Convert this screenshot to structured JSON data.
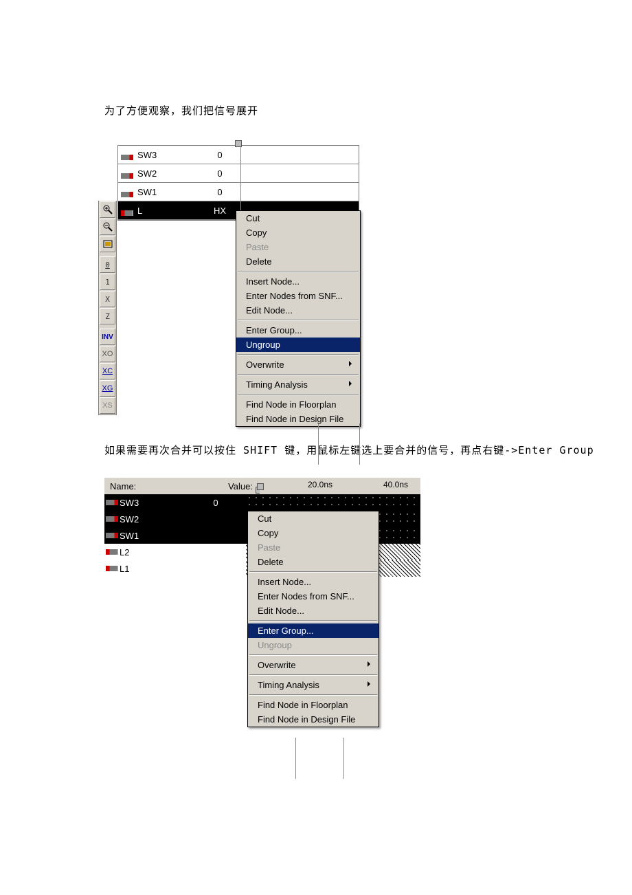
{
  "text": {
    "para1": "为了方便观察，我们把信号展开",
    "para2": "如果需要再次合并可以按住 SHIFT 键，用鼠标左键选上要合并的信号，再点右键->Enter Group"
  },
  "toolbar_icons": [
    "zoom-in",
    "zoom-out",
    "fit",
    "0",
    "1",
    "X",
    "Z",
    "INV",
    "XO",
    "XC",
    "XG",
    "XS"
  ],
  "shot1": {
    "signals": [
      {
        "name": "SW3",
        "value": "0",
        "type": "in",
        "sel": false
      },
      {
        "name": "SW2",
        "value": "0",
        "type": "in",
        "sel": false
      },
      {
        "name": "SW1",
        "value": "0",
        "type": "in",
        "sel": false
      },
      {
        "name": "L",
        "value": "HX",
        "type": "out",
        "sel": true
      }
    ],
    "menu": [
      {
        "label": "Cut",
        "t": "item"
      },
      {
        "label": "Copy",
        "t": "item"
      },
      {
        "label": "Paste",
        "t": "disabled"
      },
      {
        "label": "Delete",
        "t": "item"
      },
      {
        "t": "div"
      },
      {
        "label": "Insert Node...",
        "t": "item"
      },
      {
        "label": "Enter Nodes from SNF...",
        "t": "item"
      },
      {
        "label": "Edit Node...",
        "t": "item"
      },
      {
        "t": "div"
      },
      {
        "label": "Enter Group...",
        "t": "item"
      },
      {
        "label": "Ungroup",
        "t": "highlight"
      },
      {
        "t": "div"
      },
      {
        "label": "Overwrite",
        "t": "item",
        "sub": true
      },
      {
        "t": "div"
      },
      {
        "label": "Timing Analysis",
        "t": "item",
        "sub": true
      },
      {
        "t": "div"
      },
      {
        "label": "Find Node in Floorplan",
        "t": "item"
      },
      {
        "label": "Find Node in Design File",
        "t": "item"
      }
    ]
  },
  "shot2": {
    "header": {
      "name": "Name:",
      "value": "Value:",
      "t1": "20.0ns",
      "t2": "40.0ns"
    },
    "signals": [
      {
        "name": "SW3",
        "value": "0",
        "type": "in",
        "sel": true,
        "wv": "dots"
      },
      {
        "name": "SW2",
        "value": "",
        "type": "in",
        "sel": true,
        "wv": "dots"
      },
      {
        "name": "SW1",
        "value": "",
        "type": "in",
        "sel": true,
        "wv": "dots"
      },
      {
        "name": "L2",
        "value": "",
        "type": "out",
        "sel": false,
        "wv": "cross"
      },
      {
        "name": "L1",
        "value": "",
        "type": "out",
        "sel": false,
        "wv": "cross"
      }
    ],
    "menu": [
      {
        "label": "Cut",
        "t": "item"
      },
      {
        "label": "Copy",
        "t": "item"
      },
      {
        "label": "Paste",
        "t": "disabled"
      },
      {
        "label": "Delete",
        "t": "item"
      },
      {
        "t": "div"
      },
      {
        "label": "Insert Node...",
        "t": "item"
      },
      {
        "label": "Enter Nodes from SNF...",
        "t": "item"
      },
      {
        "label": "Edit Node...",
        "t": "item"
      },
      {
        "t": "div"
      },
      {
        "label": "Enter Group...",
        "t": "highlight"
      },
      {
        "label": "Ungroup",
        "t": "disabled"
      },
      {
        "t": "div"
      },
      {
        "label": "Overwrite",
        "t": "item",
        "sub": true
      },
      {
        "t": "div"
      },
      {
        "label": "Timing Analysis",
        "t": "item",
        "sub": true
      },
      {
        "t": "div"
      },
      {
        "label": "Find Node in Floorplan",
        "t": "item"
      },
      {
        "label": "Find Node in Design File",
        "t": "item"
      }
    ]
  }
}
